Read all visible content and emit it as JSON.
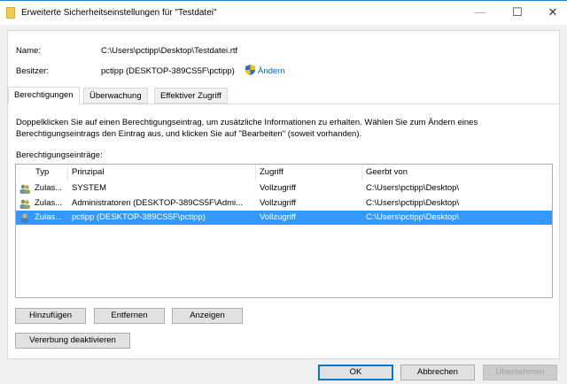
{
  "window": {
    "title": "Erweiterte Sicherheitseinstellungen für \"Testdatei\"",
    "minimize": "—",
    "maximize": "☐",
    "close": "✕"
  },
  "info": {
    "name_label": "Name:",
    "name_value": "C:\\Users\\pctipp\\Desktop\\Testdatei.rtf",
    "owner_label": "Besitzer:",
    "owner_value": "pctipp (DESKTOP-389CS5F\\pctipp)",
    "change_link": "Ändern"
  },
  "tabs": [
    {
      "label": "Berechtigungen"
    },
    {
      "label": "Überwachung"
    },
    {
      "label": "Effektiver Zugriff"
    }
  ],
  "description": "Doppelklicken Sie auf einen Berechtigungseintrag, um zusätzliche Informationen zu erhalten. Wählen Sie zum Ändern eines Berechtigungseintrags den Eintrag aus, und klicken Sie auf \"Bearbeiten\" (soweit vorhanden).",
  "entries_label": "Berechtigungseinträge:",
  "columns": [
    "Typ",
    "Prinzipal",
    "Zugriff",
    "Geerbt von"
  ],
  "rows": [
    {
      "type": "Zulas...",
      "principal": "SYSTEM",
      "access": "Vollzugriff",
      "inherited": "C:\\Users\\pctipp\\Desktop\\",
      "icon": "group-icon"
    },
    {
      "type": "Zulas...",
      "principal": "Administratoren (DESKTOP-389CS5F\\Admi...",
      "access": "Vollzugriff",
      "inherited": "C:\\Users\\pctipp\\Desktop\\",
      "icon": "group-icon"
    },
    {
      "type": "Zulas...",
      "principal": "pctipp (DESKTOP-389CS5F\\pctipp)",
      "access": "Vollzugriff",
      "inherited": "C:\\Users\\pctipp\\Desktop\\",
      "icon": "user-icon",
      "selected": true
    }
  ],
  "buttons": {
    "add": "Hinzufügen",
    "remove": "Entfernen",
    "view": "Anzeigen",
    "disable_inheritance": "Vererbung deaktivieren",
    "ok": "OK",
    "cancel": "Abbrechen",
    "apply": "Übernehmen"
  },
  "colors": {
    "selection": "#3399ff",
    "accent": "#0078d7",
    "link": "#0066cc"
  }
}
